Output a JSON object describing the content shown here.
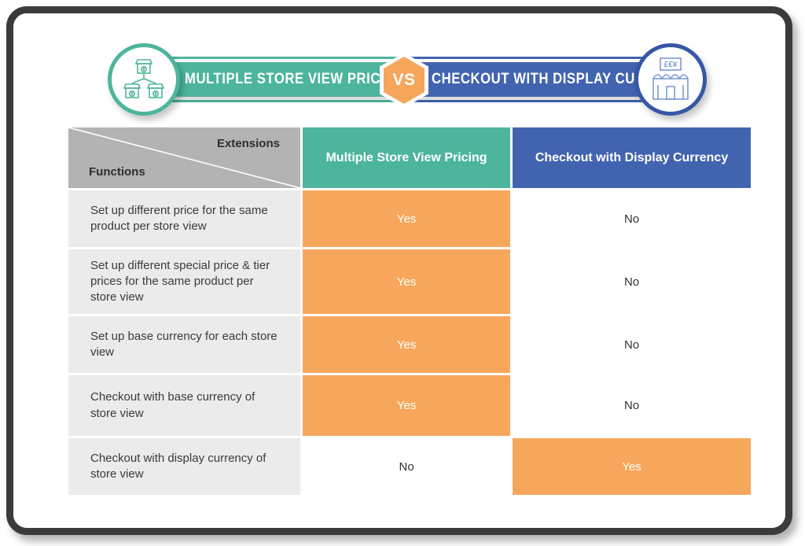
{
  "banner": {
    "left_title": "MULTIPLE STORE VIEW PRICING",
    "right_title": "CHECKOUT WITH DISPLAY CURRENCY",
    "vs_label": "VS",
    "left_icon": "three-connected-shops-icon",
    "right_icon": "shop-with-currency-board-icon",
    "colors": {
      "teal": "#4cb59b",
      "blue": "#4264b0",
      "orange": "#f7a75c"
    }
  },
  "table": {
    "corner": {
      "top_label": "Extensions",
      "bottom_label": "Functions"
    },
    "columns": [
      "Multiple Store View Pricing",
      "Checkout with Display Currency"
    ],
    "rows": [
      {
        "function": "Set up different price for the same product per store view",
        "values": [
          "Yes",
          "No"
        ]
      },
      {
        "function": "Set up different special price & tier prices for the same product per store view",
        "values": [
          "Yes",
          "No"
        ]
      },
      {
        "function": "Set up base currency for each store view",
        "values": [
          "Yes",
          "No"
        ]
      },
      {
        "function": "Checkout with base currency of store view",
        "values": [
          "Yes",
          "No"
        ]
      },
      {
        "function": "Checkout with display currency of store view",
        "values": [
          "No",
          "Yes"
        ]
      }
    ]
  }
}
